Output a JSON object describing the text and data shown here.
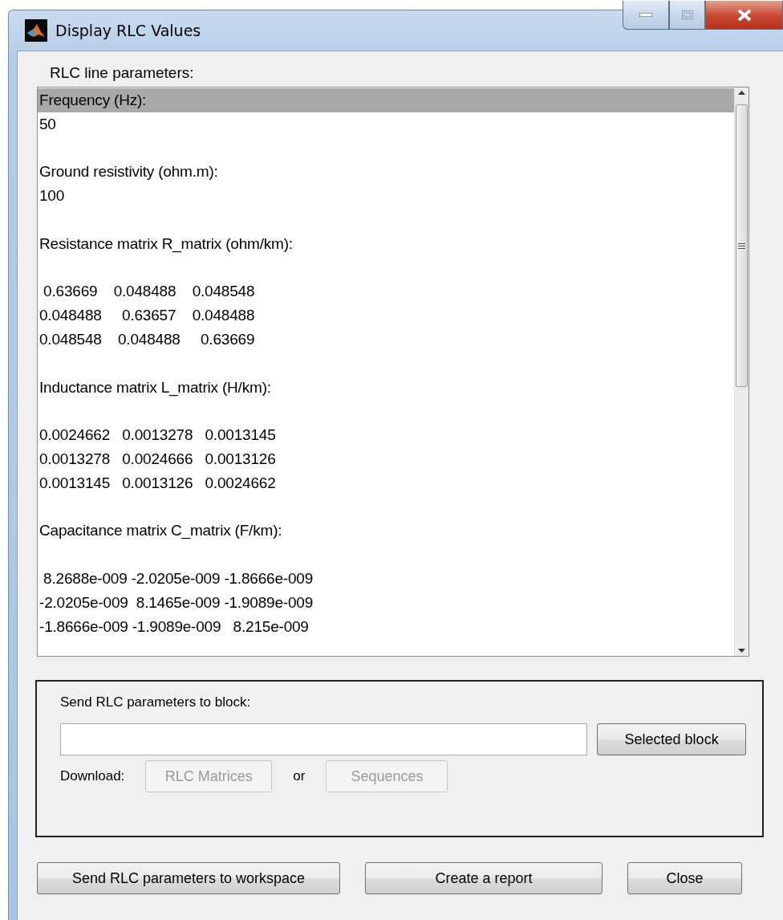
{
  "window": {
    "title": "Display RLC Values"
  },
  "listbox": {
    "label": "RLC line parameters:",
    "sections": [
      {
        "kind": "scalar",
        "heading": {
          "text": "Frequency (Hz):",
          "selected": true
        },
        "rows": [
          {
            "text": "50",
            "selected": false
          }
        ]
      },
      {
        "kind": "scalar",
        "heading": {
          "text": "Ground resistivity (ohm.m):",
          "selected": false
        },
        "rows": [
          {
            "text": "100",
            "selected": false
          }
        ]
      },
      {
        "kind": "matrix",
        "heading": {
          "text": "Resistance matrix R_matrix (ohm/km):",
          "selected": false
        },
        "rows": [
          {
            "text": " 0.63669    0.048488    0.048548",
            "selected": false
          },
          {
            "text": "0.048488     0.63657    0.048488",
            "selected": false
          },
          {
            "text": "0.048548    0.048488     0.63669",
            "selected": false
          }
        ]
      },
      {
        "kind": "matrix",
        "heading": {
          "text": "Inductance matrix L_matrix (H/km):",
          "selected": false
        },
        "rows": [
          {
            "text": "0.0024662   0.0013278   0.0013145",
            "selected": false
          },
          {
            "text": "0.0013278   0.0024666   0.0013126",
            "selected": false
          },
          {
            "text": "0.0013145   0.0013126   0.0024662",
            "selected": false
          }
        ]
      },
      {
        "kind": "matrix",
        "heading": {
          "text": "Capacitance matrix C_matrix (F/km):",
          "selected": false
        },
        "rows": [
          {
            "text": " 8.2688e-009 -2.0205e-009 -1.8666e-009",
            "selected": false
          },
          {
            "text": "-2.0205e-009  8.1465e-009 -1.9089e-009",
            "selected": false
          },
          {
            "text": "-1.8666e-009 -1.9089e-009   8.215e-009",
            "selected": false
          }
        ]
      }
    ]
  },
  "send_panel": {
    "label": "Send RLC parameters to block:",
    "selected_block_button": {
      "label": "Selected block",
      "disabled": false
    },
    "download_label": "Download:",
    "download_buttons": [
      {
        "label": "RLC Matrices",
        "disabled": true
      },
      {
        "label": "Sequences",
        "disabled": true
      }
    ],
    "or_label": "or"
  },
  "buttons": [
    {
      "label": "Send RLC parameters to workspace",
      "disabled": false
    },
    {
      "label": "Create a report",
      "disabled": false
    },
    {
      "label": "Close",
      "disabled": false
    }
  ]
}
